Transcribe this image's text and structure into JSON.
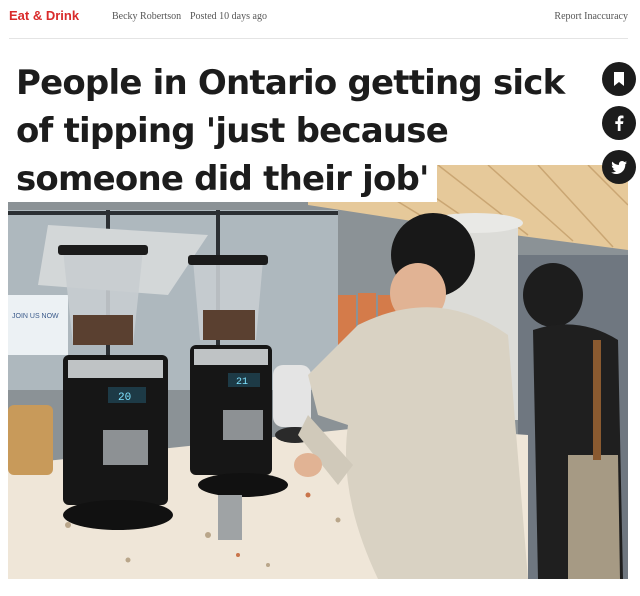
{
  "header": {
    "category": "Eat & Drink",
    "author": "Becky Robertson",
    "posted": "Posted 10 days ago",
    "report": "Report Inaccuracy"
  },
  "article": {
    "headline_lines": [
      "People in Ontario getting sick",
      "of tipping 'just because",
      "someone did their job'"
    ]
  },
  "share_buttons": [
    {
      "icon": "bookmark-icon"
    },
    {
      "icon": "facebook-icon"
    },
    {
      "icon": "twitter-icon"
    }
  ],
  "photo": {
    "grinder_left_display": "20",
    "grinder_right_display": "21",
    "window_sign": "JOIN US NOW",
    "colors": {
      "wood_ceiling": "#e6c99a",
      "counter": "#efe6d8",
      "sweater": "#d9d2c3"
    }
  },
  "theme": {
    "accent": "#d92b2b",
    "text": "#1c1c1c"
  }
}
